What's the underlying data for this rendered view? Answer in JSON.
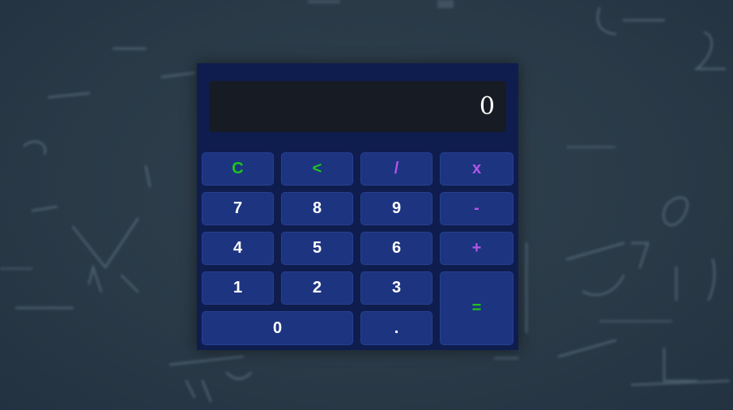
{
  "calculator": {
    "display_value": "0",
    "keys": {
      "clear": "C",
      "backspace": "<",
      "divide": "/",
      "multiply": "x",
      "seven": "7",
      "eight": "8",
      "nine": "9",
      "subtract": "-",
      "four": "4",
      "five": "5",
      "six": "6",
      "add": "+",
      "one": "1",
      "two": "2",
      "three": "3",
      "equals": "=",
      "zero": "0",
      "decimal": "."
    }
  },
  "colors": {
    "background": "#2b3b4a",
    "calculator_body": "#0f1d4e",
    "display_bg": "#171c24",
    "key_bg": "#1d3481",
    "accent_green": "#1ec41e",
    "accent_purple": "#b455e8",
    "key_text": "#ffffff"
  }
}
